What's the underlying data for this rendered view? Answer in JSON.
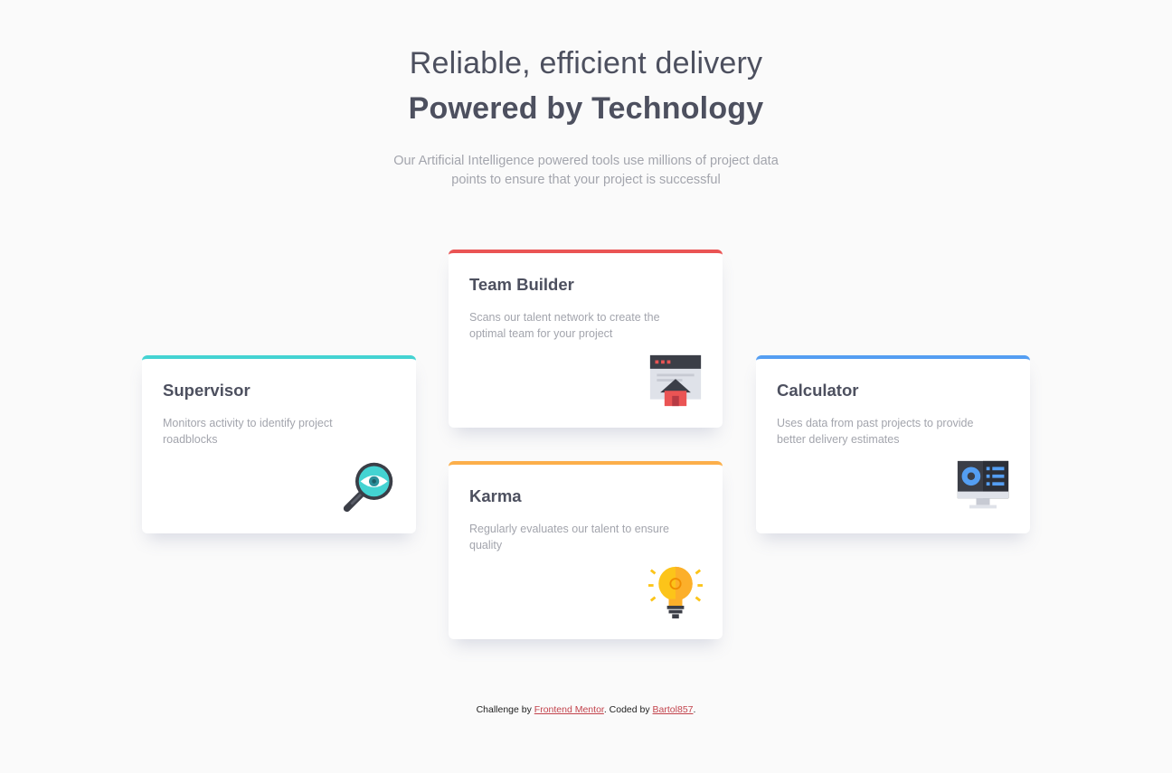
{
  "header": {
    "title_light": "Reliable, efficient delivery",
    "title_bold": "Powered by Technology",
    "subtitle": "Our Artificial Intelligence powered tools use millions of project data points to ensure that your project is successful"
  },
  "colors": {
    "cyan": "#44d3d2",
    "red": "#ea5454",
    "orange": "#fcaf4a",
    "blue": "#549ef2",
    "text_dark": "#4d505f",
    "text_grey": "#a3a5ad"
  },
  "cards": [
    {
      "title": "Supervisor",
      "description": "Monitors activity to identify project roadblocks",
      "accent": "cyan",
      "icon": "magnifier-eye-icon"
    },
    {
      "title": "Team Builder",
      "description": "Scans our talent network to create the optimal team for your project",
      "accent": "red",
      "icon": "browser-home-icon"
    },
    {
      "title": "Karma",
      "description": "Regularly evaluates our talent to ensure quality",
      "accent": "orange",
      "icon": "lightbulb-icon"
    },
    {
      "title": "Calculator",
      "description": "Uses data from past projects to provide better delivery estimates",
      "accent": "blue",
      "icon": "monitor-chart-icon"
    }
  ],
  "footer": {
    "prefix": "Challenge by",
    "link1": "Frontend Mentor",
    "middle": ". Coded by",
    "link2": "Bartol857",
    "suffix": "."
  }
}
